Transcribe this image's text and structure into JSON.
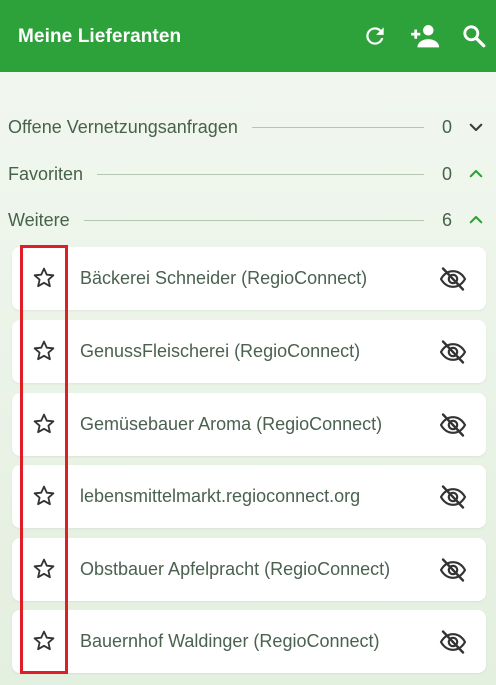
{
  "appbar": {
    "title": "Meine Lieferanten",
    "icons": [
      "refresh-icon",
      "add-user-icon",
      "search-icon"
    ]
  },
  "sections": [
    {
      "label": "Offene Vernetzungsanfragen",
      "count": "0",
      "chevron": "chevron-down-icon"
    },
    {
      "label": "Favoriten",
      "count": "0",
      "chevron": "chevron-up-icon"
    },
    {
      "label": "Weitere",
      "count": "6",
      "chevron": "chevron-up-icon"
    }
  ],
  "suppliers": [
    {
      "name": "Bäckerei Schneider (RegioConnect)"
    },
    {
      "name": "GenussFleischerei (RegioConnect)"
    },
    {
      "name": "Gemüsebauer Aroma (RegioConnect)"
    },
    {
      "name": "lebensmittelmarkt.regioconnect.org"
    },
    {
      "name": "Obstbauer Apfelpracht (RegioConnect)"
    },
    {
      "name": "Bauernhof Waldinger (RegioConnect)"
    }
  ],
  "colors": {
    "brand_green": "#2ea23a",
    "chevron_green": "#2ea23a",
    "text": "#47624a",
    "highlight": "#e01e25"
  }
}
